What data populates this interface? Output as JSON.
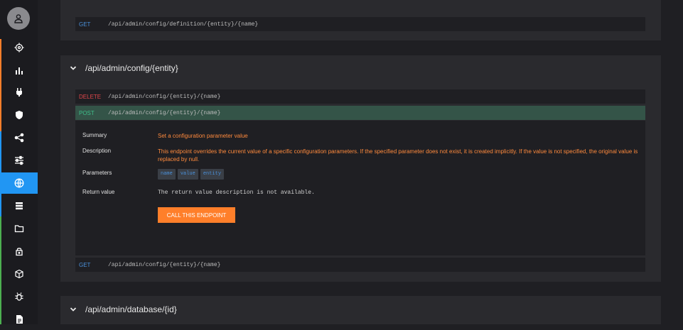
{
  "sidebar": {
    "items": [
      {
        "icon": "target-icon"
      },
      {
        "icon": "bar-chart-icon"
      },
      {
        "icon": "plug-icon"
      },
      {
        "icon": "shield-icon"
      },
      {
        "icon": "share-icon"
      },
      {
        "icon": "sliders-icon"
      },
      {
        "icon": "globe-icon",
        "active": true
      },
      {
        "icon": "database-icon"
      },
      {
        "icon": "folder-icon"
      },
      {
        "icon": "lock-icon"
      },
      {
        "icon": "cube-icon"
      },
      {
        "icon": "bug-icon"
      },
      {
        "icon": "document-icon"
      }
    ]
  },
  "cards": {
    "top": {
      "routes": [
        {
          "method": "GET",
          "path": "/api/admin/config/definition/{entity}/{name}"
        }
      ]
    },
    "config": {
      "title": "/api/admin/config/{entity}",
      "routes": [
        {
          "method": "DELETE",
          "path": "/api/admin/config/{entity}/{name}"
        },
        {
          "method": "POST",
          "path": "/api/admin/config/{entity}/{name}"
        },
        {
          "method": "GET",
          "path": "/api/admin/config/{entity}/{name}"
        }
      ],
      "details": {
        "summary_label": "Summary",
        "summary": "Set a configuration parameter value",
        "description_label": "Description",
        "description": "This endpoint overrides the current value of a specific configuration parameters. If the specified parameter does not exist, it is created implicitly. If the value is not specified, the original value is replaced by null.",
        "parameters_label": "Parameters",
        "parameters": [
          "name",
          "value",
          "entity"
        ],
        "return_label": "Return value",
        "return_value": "The return value description is not available.",
        "call_button": "CALL THIS ENDPOINT"
      }
    },
    "database": {
      "title": "/api/admin/database/{id}"
    }
  },
  "colors": {
    "accent": "#2196f3",
    "button": "#ff7f2a",
    "get": "#4a90d9",
    "delete": "#e0464a",
    "post": "#3fbf8a"
  }
}
